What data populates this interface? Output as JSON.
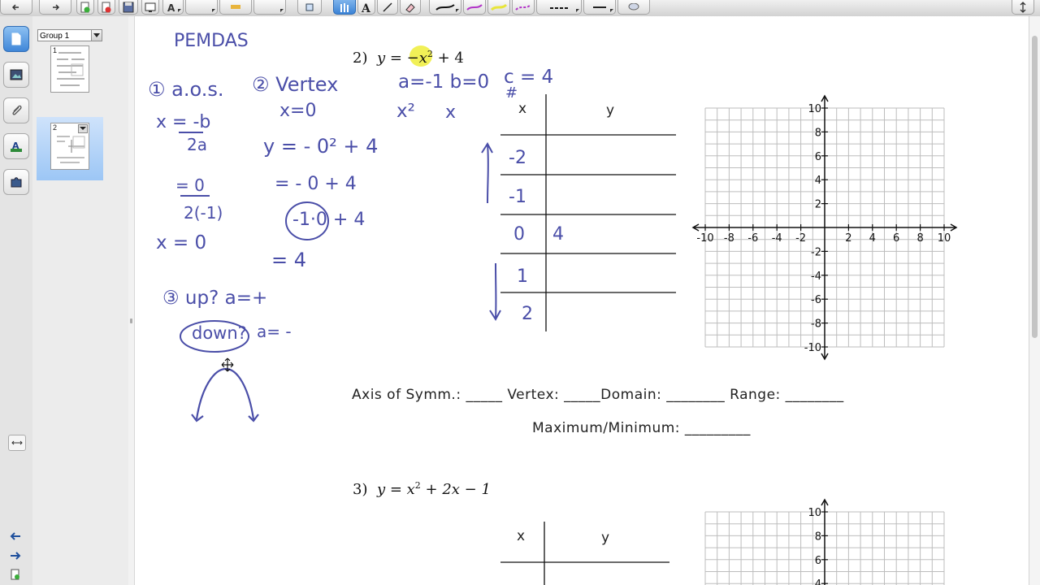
{
  "sidebar": {
    "group_label": "Group 1",
    "pages": [
      {
        "number": "1"
      },
      {
        "number": "2"
      }
    ]
  },
  "problems": [
    {
      "number": "2)",
      "equation": {
        "lhs": "y = ",
        "neg": "−x",
        "exp": "2",
        "rest": " + 4"
      },
      "table": {
        "col_x": "x",
        "col_y": "y"
      },
      "answers_line1": "Axis of Symm.: _____ Vertex: _____Domain: ________ Range: ________",
      "answers_line2": "Maximum/Minimum: _________"
    },
    {
      "number": "3)",
      "equation": {
        "lhs": "y = x",
        "exp": "2",
        "rest": " + 2x − 1"
      },
      "table": {
        "col_x": "x",
        "col_y": "y"
      }
    }
  ],
  "graph": {
    "x_ticks": [
      "-10",
      "-8",
      "-6",
      "-4",
      "-2",
      "2",
      "4",
      "6",
      "8",
      "10"
    ],
    "y_ticks": [
      "10",
      "8",
      "6",
      "4",
      "2",
      "-2",
      "-4",
      "-6",
      "-8",
      "-10"
    ]
  },
  "handwriting": {
    "pemdas": "PEMDAS",
    "aos_step": "① a.o.s.",
    "aos_formula_num": "x = -b",
    "aos_formula_den": "2a",
    "aos_sub_num": "= 0",
    "aos_sub_den": "2(-1)",
    "aos_result": "x = 0",
    "vertex_step": "② Vertex",
    "vertex_x": "x=0",
    "vertex_y1": "y = - 0² + 4",
    "vertex_y2": "= - 0 + 4",
    "vertex_y3": "-1·0 + 4",
    "vertex_y4": "= 4",
    "updown_step": "③ up? a=+",
    "down_label": "down?",
    "down_cond": "a= -",
    "coeffs": "a=-1  b=0",
    "c_coeff": "c = 4",
    "hash": "#",
    "x2_label": "x²",
    "x_label": "x",
    "table_x": [
      "-2",
      "-1",
      "0",
      "1",
      "2"
    ],
    "table_y0": "4"
  }
}
